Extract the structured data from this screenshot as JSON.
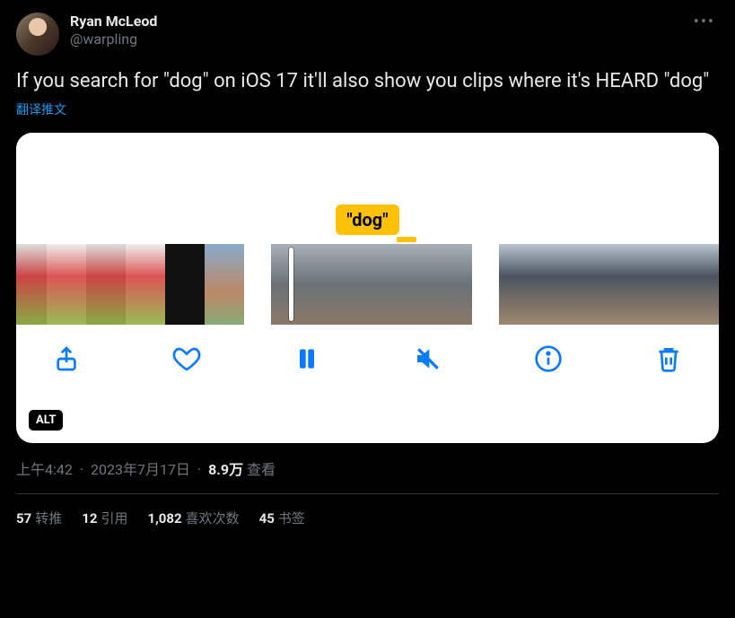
{
  "author": {
    "display_name": "Ryan McLeod",
    "handle": "@warpling"
  },
  "body": "If you search for \"dog\" on iOS 17 it'll also show you clips where it's HEARD \"dog\"",
  "translate_label": "翻译推文",
  "media": {
    "search_token": "\"dog\"",
    "alt_badge": "ALT",
    "toolbar": {
      "share": "share-icon",
      "like": "heart-icon",
      "pause": "pause-icon",
      "mute": "mute-icon",
      "info": "info-icon",
      "trash": "trash-icon"
    }
  },
  "meta": {
    "time": "上午4:42",
    "date": "2023年7月17日",
    "views_number": "8.9万",
    "views_label": "查看"
  },
  "stats": {
    "retweets": {
      "count": "57",
      "label": "转推"
    },
    "quotes": {
      "count": "12",
      "label": "引用"
    },
    "likes": {
      "count": "1,082",
      "label": "喜欢次数"
    },
    "bookmarks": {
      "count": "45",
      "label": "书签"
    }
  }
}
